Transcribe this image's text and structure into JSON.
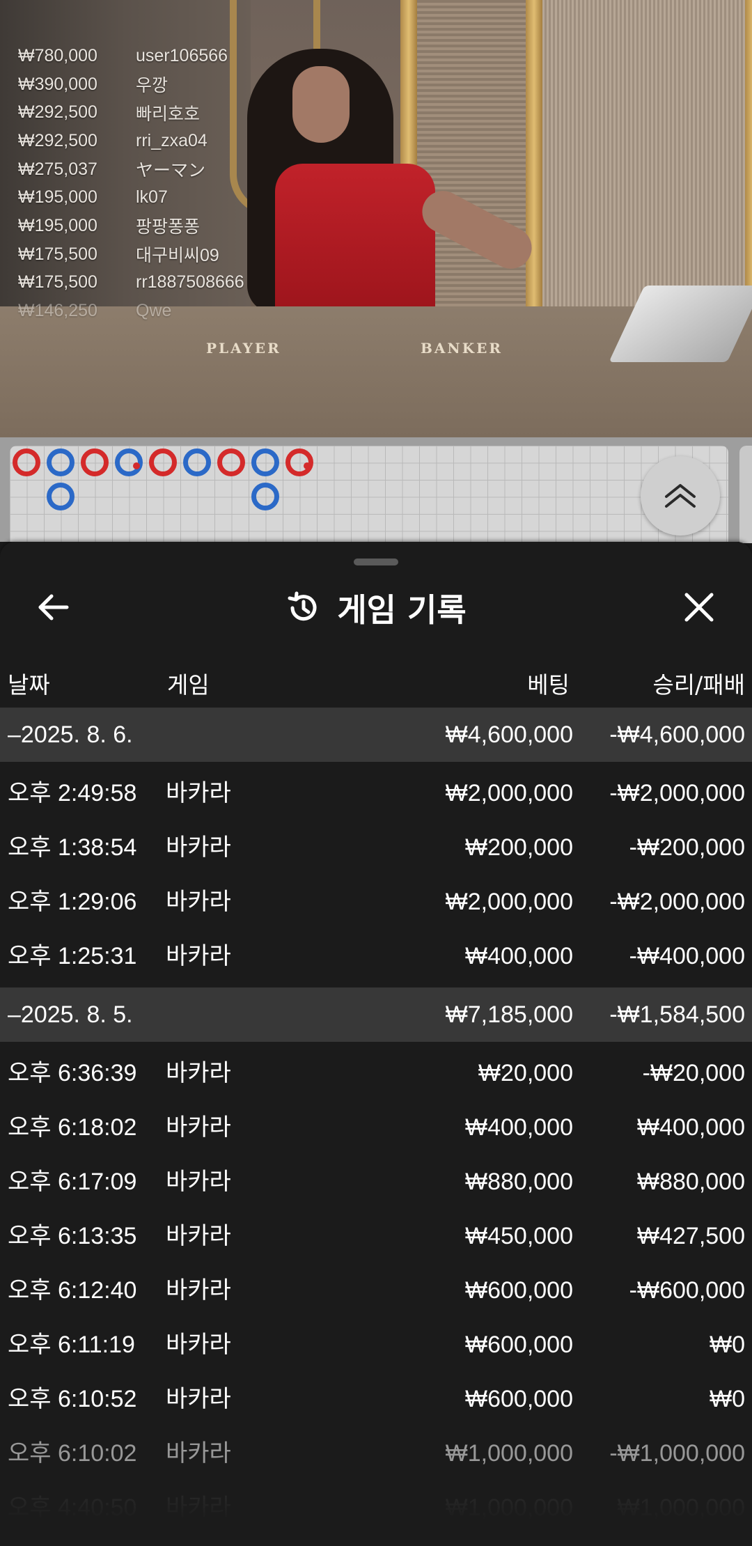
{
  "leaderboard": [
    {
      "amount": "₩780,000",
      "name": "user106566"
    },
    {
      "amount": "₩390,000",
      "name": "우깡"
    },
    {
      "amount": "₩292,500",
      "name": "빠리호호"
    },
    {
      "amount": "₩292,500",
      "name": "rri_zxa04"
    },
    {
      "amount": "₩275,037",
      "name": "ヤーマン"
    },
    {
      "amount": "₩195,000",
      "name": "lk07"
    },
    {
      "amount": "₩195,000",
      "name": "팡팡퐁퐁"
    },
    {
      "amount": "₩175,500",
      "name": "대구비씨09"
    },
    {
      "amount": "₩175,500",
      "name": "rr1887508666"
    },
    {
      "amount": "₩146,250",
      "name": "Qwe"
    }
  ],
  "table": {
    "player_label": "PLAYER",
    "banker_label": "BANKER"
  },
  "roadmap": {
    "colors": {
      "banker": "#d42a2a",
      "player": "#2b69c7"
    },
    "columns": [
      [
        "B"
      ],
      [
        "P",
        "P"
      ],
      [
        "B"
      ],
      [
        "P"
      ],
      [
        "B"
      ],
      [
        "P"
      ],
      [
        "B"
      ],
      [
        "P",
        "P"
      ],
      [
        "B"
      ]
    ]
  },
  "sheet": {
    "title": "게임 기록",
    "icons": {
      "back": "arrow-left-icon",
      "history": "history-icon",
      "close": "close-icon",
      "scroll_up": "double-chevron-up-icon"
    },
    "columns": {
      "date": "날짜",
      "game": "게임",
      "bet": "베팅",
      "result": "승리/패배"
    },
    "groups": [
      {
        "date": "–2025. 8. 6.",
        "bet": "₩4,600,000",
        "result": "-₩4,600,000",
        "rows": [
          {
            "time": "오후 2:49:58",
            "game": "바카라",
            "bet": "₩2,000,000",
            "result": "-₩2,000,000"
          },
          {
            "time": "오후 1:38:54",
            "game": "바카라",
            "bet": "₩200,000",
            "result": "-₩200,000"
          },
          {
            "time": "오후 1:29:06",
            "game": "바카라",
            "bet": "₩2,000,000",
            "result": "-₩2,000,000"
          },
          {
            "time": "오후 1:25:31",
            "game": "바카라",
            "bet": "₩400,000",
            "result": "-₩400,000"
          }
        ]
      },
      {
        "date": "–2025. 8. 5.",
        "bet": "₩7,185,000",
        "result": "-₩1,584,500",
        "rows": [
          {
            "time": "오후 6:36:39",
            "game": "바카라",
            "bet": "₩20,000",
            "result": "-₩20,000"
          },
          {
            "time": "오후 6:18:02",
            "game": "바카라",
            "bet": "₩400,000",
            "result": "₩400,000"
          },
          {
            "time": "오후 6:17:09",
            "game": "바카라",
            "bet": "₩880,000",
            "result": "₩880,000"
          },
          {
            "time": "오후 6:13:35",
            "game": "바카라",
            "bet": "₩450,000",
            "result": "₩427,500"
          },
          {
            "time": "오후 6:12:40",
            "game": "바카라",
            "bet": "₩600,000",
            "result": "-₩600,000"
          },
          {
            "time": "오후 6:11:19",
            "game": "바카라",
            "bet": "₩600,000",
            "result": "₩0"
          },
          {
            "time": "오후 6:10:52",
            "game": "바카라",
            "bet": "₩600,000",
            "result": "₩0"
          },
          {
            "time": "오후 6:10:02",
            "game": "바카라",
            "bet": "₩1,000,000",
            "result": "-₩1,000,000"
          },
          {
            "time": "오후 4:40:50",
            "game": "바카라",
            "bet": "₩1,000,000",
            "result": "₩1,000,000"
          }
        ]
      }
    ]
  }
}
